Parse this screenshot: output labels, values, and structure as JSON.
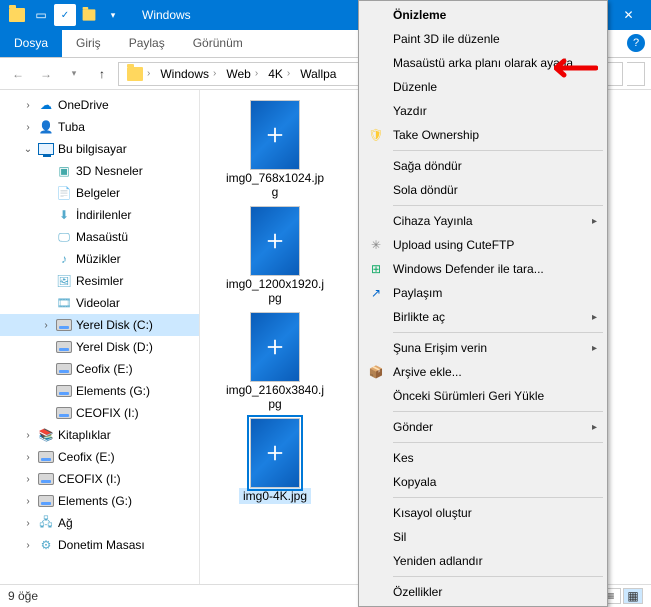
{
  "titlebar": {
    "title": "Windows"
  },
  "ribbon": {
    "file": "Dosya",
    "tabs": [
      "Giriş",
      "Paylaş",
      "Görünüm"
    ]
  },
  "breadcrumb": [
    "Windows",
    "Web",
    "4K",
    "Wallpa"
  ],
  "sidebar": [
    {
      "label": "OneDrive",
      "expand": "›",
      "level": 1,
      "icon": "cloud"
    },
    {
      "label": "Tuba",
      "expand": "›",
      "level": 1,
      "icon": "user"
    },
    {
      "label": "Bu bilgisayar",
      "expand": "⌄",
      "level": 1,
      "icon": "pc"
    },
    {
      "label": "3D Nesneler",
      "expand": "",
      "level": 2,
      "icon": "folder3d"
    },
    {
      "label": "Belgeler",
      "expand": "",
      "level": 2,
      "icon": "docs"
    },
    {
      "label": "İndirilenler",
      "expand": "",
      "level": 2,
      "icon": "downloads"
    },
    {
      "label": "Masaüstü",
      "expand": "",
      "level": 2,
      "icon": "desktop"
    },
    {
      "label": "Müzikler",
      "expand": "",
      "level": 2,
      "icon": "music"
    },
    {
      "label": "Resimler",
      "expand": "",
      "level": 2,
      "icon": "pictures"
    },
    {
      "label": "Videolar",
      "expand": "",
      "level": 2,
      "icon": "videos"
    },
    {
      "label": "Yerel Disk (C:)",
      "expand": "›",
      "level": 2,
      "icon": "disk",
      "selected": true
    },
    {
      "label": "Yerel Disk (D:)",
      "expand": "",
      "level": 2,
      "icon": "disk"
    },
    {
      "label": "Ceofix (E:)",
      "expand": "",
      "level": 2,
      "icon": "disk"
    },
    {
      "label": "Elements (G:)",
      "expand": "",
      "level": 2,
      "icon": "disk"
    },
    {
      "label": "CEOFIX (I:)",
      "expand": "",
      "level": 2,
      "icon": "disk"
    },
    {
      "label": "Kitaplıklar",
      "expand": "›",
      "level": 1,
      "icon": "libs"
    },
    {
      "label": "Ceofix (E:)",
      "expand": "›",
      "level": 1,
      "icon": "disk"
    },
    {
      "label": "CEOFIX (I:)",
      "expand": "›",
      "level": 1,
      "icon": "disk"
    },
    {
      "label": "Elements (G:)",
      "expand": "›",
      "level": 1,
      "icon": "disk"
    },
    {
      "label": "Ağ",
      "expand": "›",
      "level": 1,
      "icon": "network"
    },
    {
      "label": "Donetim Masası",
      "expand": "›",
      "level": 1,
      "icon": "control"
    }
  ],
  "files": [
    {
      "label": "img0_768x1024.jpg",
      "selected": false
    },
    {
      "label": "img0_1200x1920.jpg",
      "selected": false
    },
    {
      "label": "img0_2160x3840.jpg",
      "selected": false
    },
    {
      "label": "img0-4K.jpg",
      "selected": true
    }
  ],
  "status": {
    "count": "9 öğe"
  },
  "context_menu": [
    {
      "type": "item",
      "label": "Önizleme",
      "bold": true
    },
    {
      "type": "item",
      "label": "Paint 3D ile düzenle"
    },
    {
      "type": "item",
      "label": "Masaüstü arka planı olarak ayarla"
    },
    {
      "type": "item",
      "label": "Düzenle"
    },
    {
      "type": "item",
      "label": "Yazdır"
    },
    {
      "type": "item",
      "label": "Take Ownership",
      "icon": "shield"
    },
    {
      "type": "sep"
    },
    {
      "type": "item",
      "label": "Sağa döndür"
    },
    {
      "type": "item",
      "label": "Sola döndür"
    },
    {
      "type": "sep"
    },
    {
      "type": "item",
      "label": "Cihaza Yayınla",
      "sub": true
    },
    {
      "type": "item",
      "label": "Upload using CuteFTP",
      "icon": "cuteftp"
    },
    {
      "type": "item",
      "label": "Windows Defender ile tara...",
      "icon": "defender"
    },
    {
      "type": "item",
      "label": "Paylaşım",
      "icon": "share"
    },
    {
      "type": "item",
      "label": "Birlikte aç",
      "sub": true
    },
    {
      "type": "sep"
    },
    {
      "type": "item",
      "label": "Şuna Erişim verin",
      "sub": true
    },
    {
      "type": "item",
      "label": "Arşive ekle...",
      "icon": "rar"
    },
    {
      "type": "item",
      "label": "Önceki Sürümleri Geri Yükle"
    },
    {
      "type": "sep"
    },
    {
      "type": "item",
      "label": "Gönder",
      "sub": true
    },
    {
      "type": "sep"
    },
    {
      "type": "item",
      "label": "Kes"
    },
    {
      "type": "item",
      "label": "Kopyala"
    },
    {
      "type": "sep"
    },
    {
      "type": "item",
      "label": "Kısayol oluştur"
    },
    {
      "type": "item",
      "label": "Sil"
    },
    {
      "type": "item",
      "label": "Yeniden adlandır"
    },
    {
      "type": "sep"
    },
    {
      "type": "item",
      "label": "Özellikler"
    }
  ]
}
